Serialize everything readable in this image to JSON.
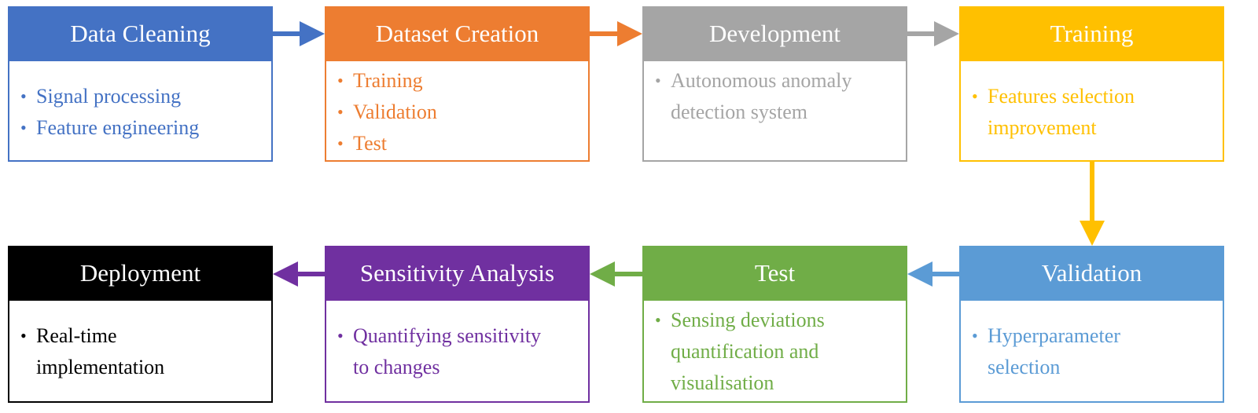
{
  "diagram": {
    "steps": [
      {
        "title": "Data Cleaning",
        "color": "#4472C4",
        "items": [
          "Signal processing",
          "Feature engineering"
        ]
      },
      {
        "title": "Dataset Creation",
        "color": "#ED7D31",
        "items": [
          "Training",
          "Validation",
          "Test"
        ]
      },
      {
        "title": "Development",
        "color": "#A5A5A5",
        "items": [
          "Autonomous anomaly detection system"
        ]
      },
      {
        "title": "Training",
        "color": "#FFC000",
        "items": [
          "Features selection improvement"
        ]
      },
      {
        "title": "Validation",
        "color": "#5B9BD5",
        "items": [
          "Hyperparameter selection"
        ]
      },
      {
        "title": "Test",
        "color": "#70AD47",
        "items": [
          "Sensing deviations quantification and visualisation"
        ]
      },
      {
        "title": "Sensitivity Analysis",
        "color": "#7030A0",
        "items": [
          "Quantifying sensitivity to changes"
        ]
      },
      {
        "title": "Deployment",
        "color": "#000000",
        "items": [
          "Real-time implementation"
        ]
      }
    ],
    "arrows": [
      {
        "from": "Data Cleaning",
        "to": "Dataset Creation",
        "color": "#4472C4"
      },
      {
        "from": "Dataset Creation",
        "to": "Development",
        "color": "#ED7D31"
      },
      {
        "from": "Development",
        "to": "Training",
        "color": "#A5A5A5"
      },
      {
        "from": "Training",
        "to": "Validation",
        "color": "#FFC000"
      },
      {
        "from": "Validation",
        "to": "Test",
        "color": "#5B9BD5"
      },
      {
        "from": "Test",
        "to": "Sensitivity Analysis",
        "color": "#70AD47"
      },
      {
        "from": "Sensitivity Analysis",
        "to": "Deployment",
        "color": "#7030A0"
      }
    ]
  }
}
